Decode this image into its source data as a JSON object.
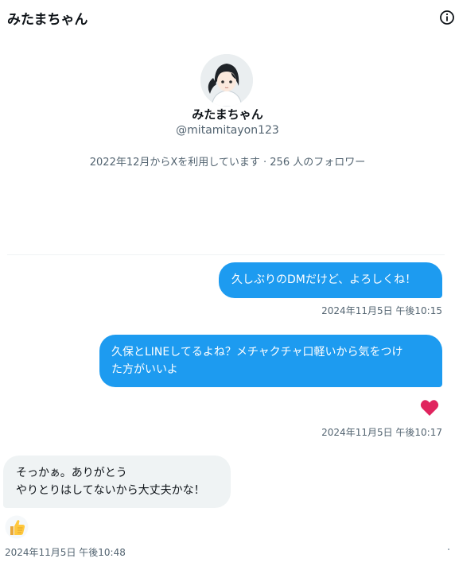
{
  "header": {
    "title": "みたまちゃん",
    "info_icon": "info-circle-icon"
  },
  "profile": {
    "name": "みたまちゃん",
    "handle": "@mitamitayon123",
    "meta": "2022年12月からXを利用しています · 256 人のフォロワー"
  },
  "messages": [
    {
      "direction": "sent",
      "lines": [
        "久しぶりのDMだけど、よろしくね！"
      ],
      "timestamp": "2024年11月5日 午後10:15"
    },
    {
      "direction": "sent",
      "lines": [
        "久保とLINEしてるよね？メチャクチャ口軽いから気をつけ",
        "た方がいいよ"
      ],
      "reaction": "heart-icon",
      "timestamp": "2024年11月5日 午後10:17"
    },
    {
      "direction": "received",
      "lines": [
        "そっかぁ。ありがとう",
        "やりとりはしてないから大丈夫かな！"
      ],
      "reaction": "thumbs-up-icon",
      "timestamp": "2024年11月5日 午後10:48"
    }
  ],
  "colors": {
    "sent_bubble": "#1d9bf0",
    "received_bubble": "#eff3f4",
    "heart": "#e0245e",
    "secondary_text": "#536471"
  }
}
